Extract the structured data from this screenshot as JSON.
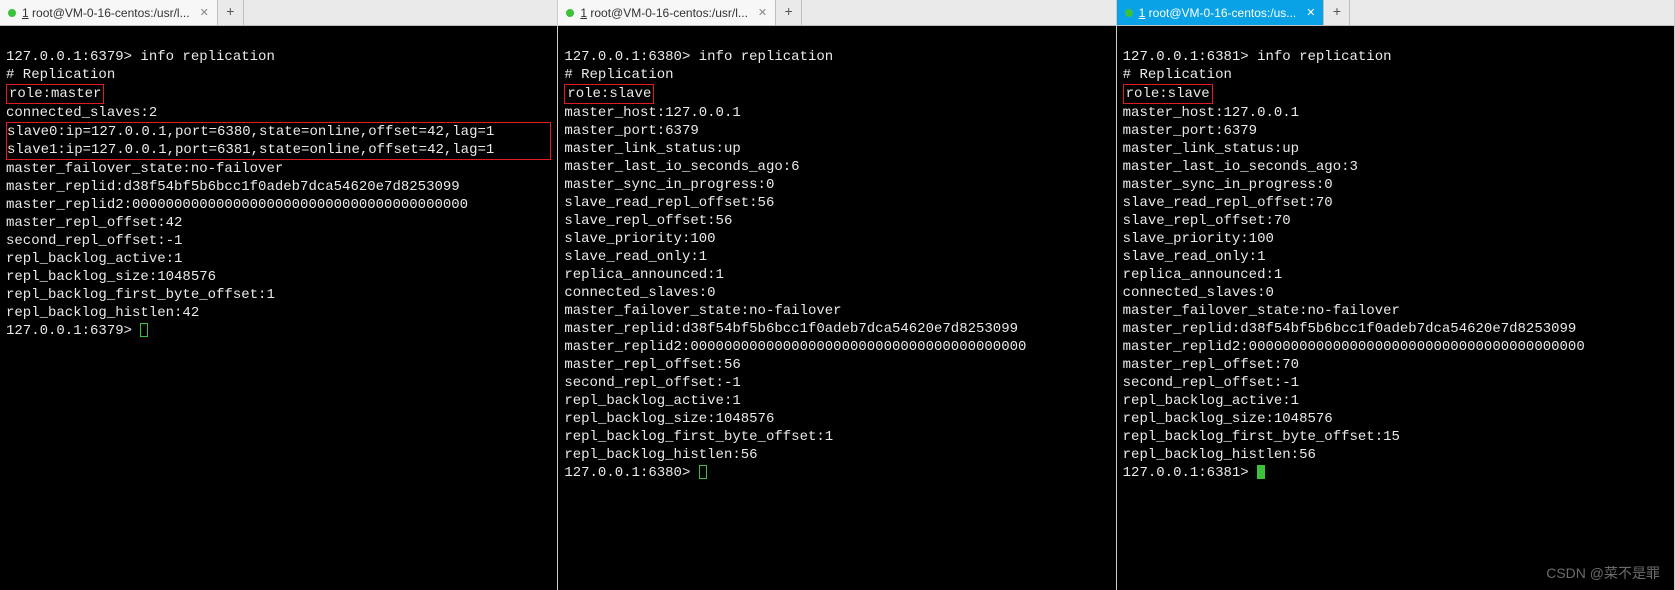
{
  "watermark": "CSDN @菜不是罪",
  "panes": [
    {
      "tab_prefix": "1",
      "tab_title": " root@VM-0-16-centos:/usr/l...",
      "tab_active_style": "gray",
      "prompt1": "127.0.0.1:6379> ",
      "command": "info replication",
      "header": "# Replication",
      "role_line": "role:master",
      "lines_after_role": [
        "connected_slaves:2"
      ],
      "boxed_lines": [
        "slave0:ip=127.0.0.1,port=6380,state=online,offset=42,lag=1",
        "slave1:ip=127.0.0.1,port=6381,state=online,offset=42,lag=1"
      ],
      "rest_lines": [
        "master_failover_state:no-failover",
        "master_replid:d38f54bf5b6bcc1f0adeb7dca54620e7d8253099",
        "master_replid2:0000000000000000000000000000000000000000",
        "master_repl_offset:42",
        "second_repl_offset:-1",
        "repl_backlog_active:1",
        "repl_backlog_size:1048576",
        "repl_backlog_first_byte_offset:1",
        "repl_backlog_histlen:42"
      ],
      "prompt2": "127.0.0.1:6379> ",
      "cursor": "hollow"
    },
    {
      "tab_prefix": "1",
      "tab_title": " root@VM-0-16-centos:/usr/l...",
      "tab_active_style": "gray",
      "prompt1": "127.0.0.1:6380> ",
      "command": "info replication",
      "header": "# Replication",
      "role_line": "role:slave",
      "lines_after_role": [],
      "boxed_lines": [],
      "rest_lines": [
        "master_host:127.0.0.1",
        "master_port:6379",
        "master_link_status:up",
        "master_last_io_seconds_ago:6",
        "master_sync_in_progress:0",
        "slave_read_repl_offset:56",
        "slave_repl_offset:56",
        "slave_priority:100",
        "slave_read_only:1",
        "replica_announced:1",
        "connected_slaves:0",
        "master_failover_state:no-failover",
        "master_replid:d38f54bf5b6bcc1f0adeb7dca54620e7d8253099",
        "master_replid2:0000000000000000000000000000000000000000",
        "master_repl_offset:56",
        "second_repl_offset:-1",
        "repl_backlog_active:1",
        "repl_backlog_size:1048576",
        "repl_backlog_first_byte_offset:1",
        "repl_backlog_histlen:56"
      ],
      "prompt2": "127.0.0.1:6380> ",
      "cursor": "hollow"
    },
    {
      "tab_prefix": "1",
      "tab_title": " root@VM-0-16-centos:/us...",
      "tab_active_style": "blue",
      "prompt1": "127.0.0.1:6381> ",
      "command": "info replication",
      "header": "# Replication",
      "role_line": "role:slave",
      "lines_after_role": [],
      "boxed_lines": [],
      "rest_lines": [
        "master_host:127.0.0.1",
        "master_port:6379",
        "master_link_status:up",
        "master_last_io_seconds_ago:3",
        "master_sync_in_progress:0",
        "slave_read_repl_offset:70",
        "slave_repl_offset:70",
        "slave_priority:100",
        "slave_read_only:1",
        "replica_announced:1",
        "connected_slaves:0",
        "master_failover_state:no-failover",
        "master_replid:d38f54bf5b6bcc1f0adeb7dca54620e7d8253099",
        "master_replid2:0000000000000000000000000000000000000000",
        "master_repl_offset:70",
        "second_repl_offset:-1",
        "repl_backlog_active:1",
        "repl_backlog_size:1048576",
        "repl_backlog_first_byte_offset:15",
        "repl_backlog_histlen:56"
      ],
      "prompt2": "127.0.0.1:6381> ",
      "cursor": "solid"
    }
  ]
}
